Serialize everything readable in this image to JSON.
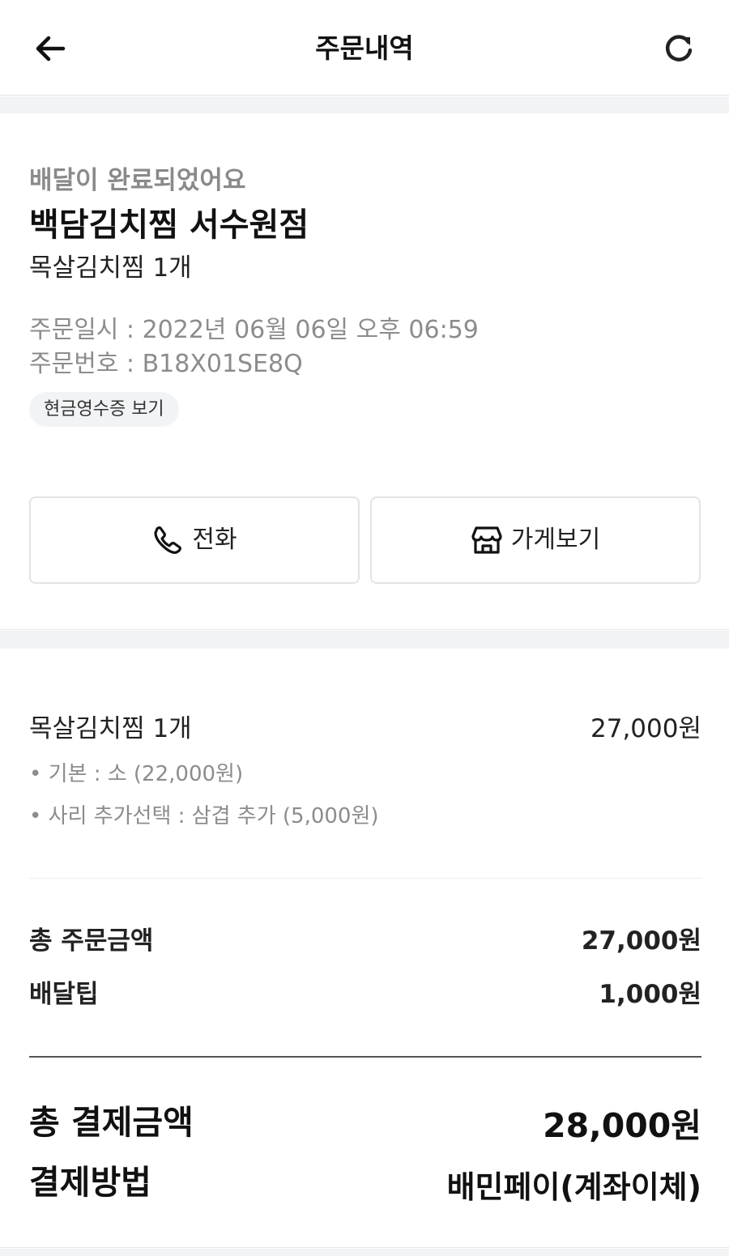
{
  "header": {
    "title": "주문내역",
    "back_icon": "arrow-left-icon",
    "refresh_icon": "refresh-icon"
  },
  "order": {
    "status": "배달이 완료되었어요",
    "store_name": "백담김치찜 서수원점",
    "menu_summary": "목살김치찜 1개",
    "date_line": "주문일시 : 2022년 06월 06일 오후 06:59",
    "number_line": "주문번호 : B18X01SE8Q",
    "receipt_label": "현금영수증 보기"
  },
  "actions": {
    "call_label": "전화",
    "call_icon": "phone-icon",
    "store_label": "가게보기",
    "store_icon": "store-icon"
  },
  "items": [
    {
      "name": "목살김치찜 1개",
      "price": "27,000원",
      "options": [
        "• 기본 : 소 (22,000원)",
        "• 사리 추가선택 : 삼겹 추가 (5,000원)"
      ]
    }
  ],
  "summary": {
    "order_total_label": "총 주문금액",
    "order_total_value": "27,000원",
    "delivery_tip_label": "배달팁",
    "delivery_tip_value": "1,000원"
  },
  "payment": {
    "total_label": "총 결제금액",
    "total_value": "28,000원",
    "method_label": "결제방법",
    "method_value": "배민페이(계좌이체)"
  }
}
